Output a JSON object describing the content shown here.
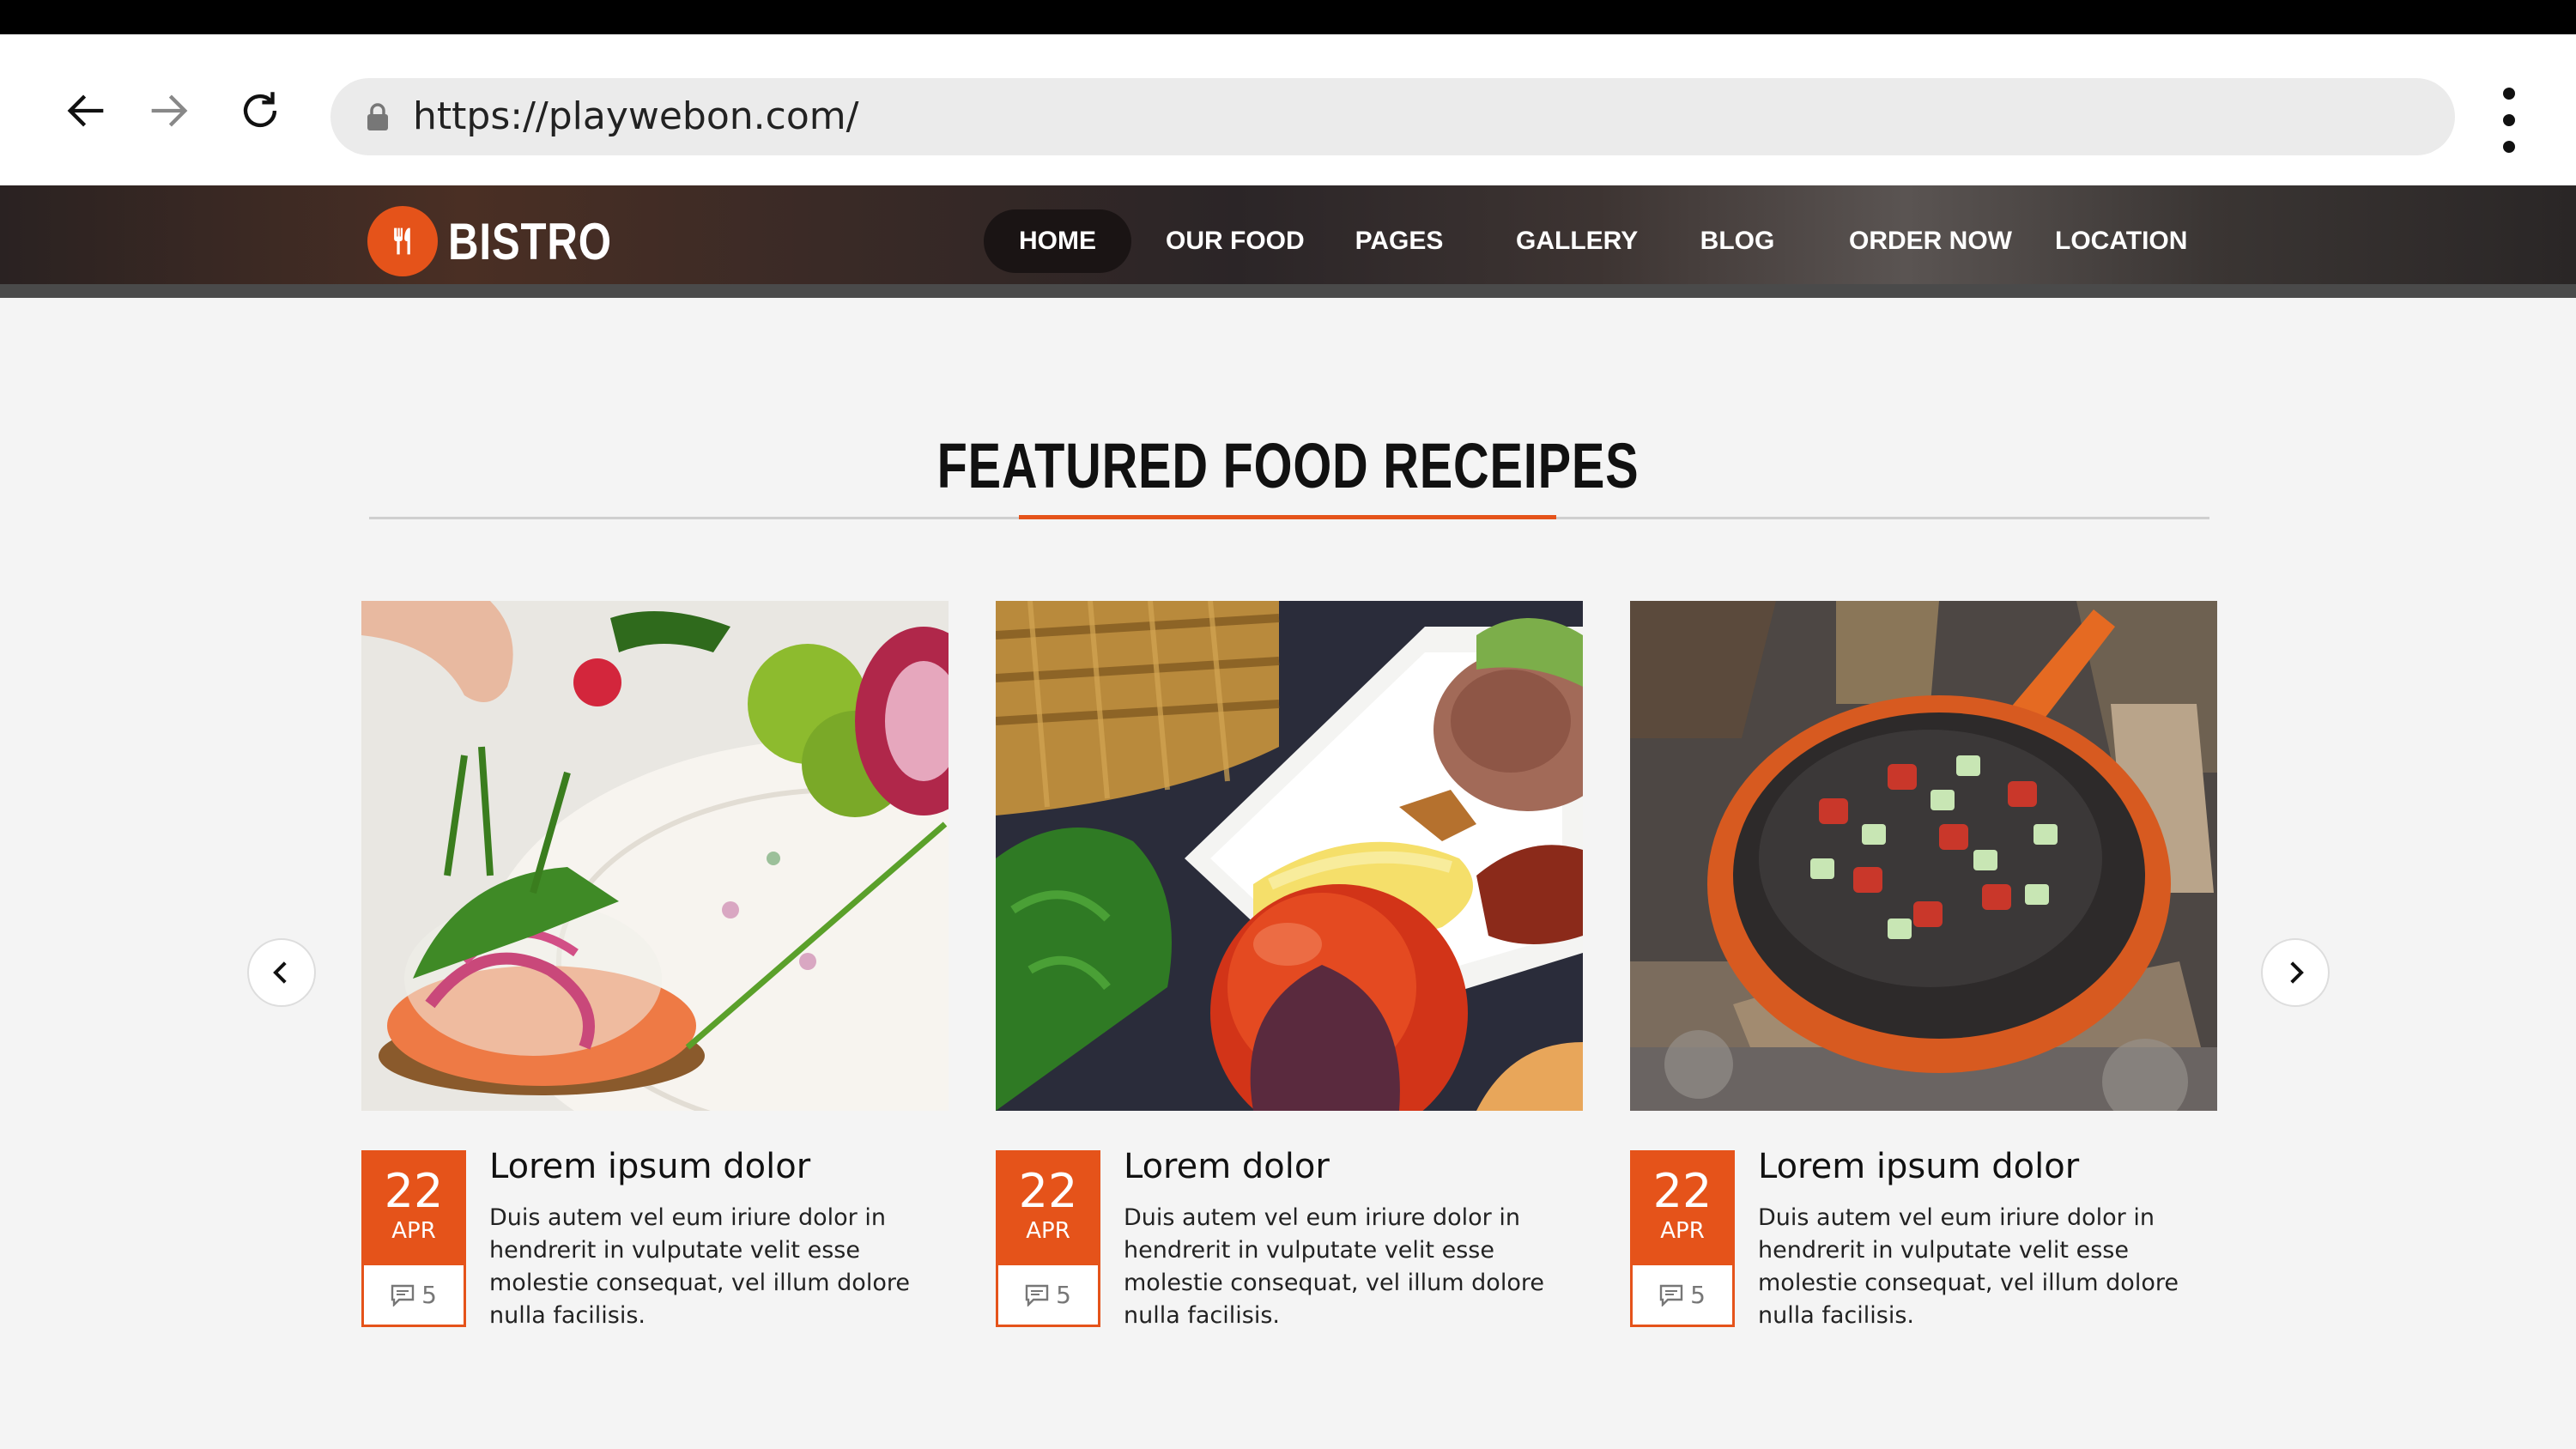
{
  "browser": {
    "url": "https://playwebon.com/",
    "back_icon": "back-arrow-icon",
    "forward_icon": "forward-arrow-icon",
    "reload_icon": "reload-icon",
    "lock_icon": "lock-icon",
    "menu_icon": "kebab-menu-icon"
  },
  "site": {
    "logo_text": "BISTRO",
    "logo_icon": "fork-knife-icon",
    "accent_color": "#e5531a"
  },
  "nav": {
    "items": [
      {
        "label": "HOME",
        "active": true
      },
      {
        "label": "OUR FOOD"
      },
      {
        "label": "PAGES"
      },
      {
        "label": "GALLERY"
      },
      {
        "label": "BLOG"
      },
      {
        "label": "ORDER NOW"
      },
      {
        "label": "LOCATION"
      }
    ]
  },
  "featured": {
    "title": "FEATURED FOOD RECEIPES",
    "prev_icon": "chevron-left-icon",
    "next_icon": "chevron-right-icon",
    "cards": [
      {
        "image": "salmon-toast-plate",
        "day": "22",
        "month": "APR",
        "comments": "5",
        "title": "Lorem ipsum dolor",
        "text": "Duis autem vel eum iriure dolor in hendrerit in vulputate velit esse molestie consequat, vel illum dolore nulla facilisis."
      },
      {
        "image": "rice-and-vegetables-plate",
        "day": "22",
        "month": "APR",
        "comments": "5",
        "title": "Lorem dolor",
        "text": "Duis autem vel eum iriure dolor in hendrerit in vulputate velit esse molestie consequat, vel illum dolore nulla facilisis."
      },
      {
        "image": "pan-over-campfire",
        "day": "22",
        "month": "APR",
        "comments": "5",
        "title": "Lorem ipsum dolor",
        "text": "Duis autem vel eum iriure dolor in hendrerit in vulputate velit esse molestie consequat, vel illum dolore nulla facilisis."
      }
    ]
  }
}
